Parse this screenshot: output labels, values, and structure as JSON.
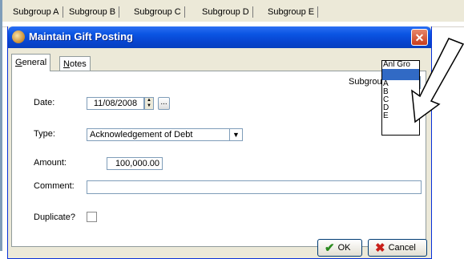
{
  "background_grid": {
    "columns": [
      "Subgroup A",
      "Subgroup B",
      "Subgroup C",
      "Subgroup D",
      "Subgroup E"
    ]
  },
  "dialog": {
    "title": "Maintain Gift Posting",
    "close_glyph": "✕",
    "tabs": [
      {
        "label": "General",
        "active": true
      },
      {
        "label": "Notes",
        "active": false
      }
    ],
    "subgroup": {
      "label": "Subgroup:",
      "options": [
        "Anl Gro",
        "",
        "A",
        "B",
        "C",
        "D",
        "E"
      ],
      "selected_index": 1
    },
    "date": {
      "label": "Date:",
      "value": "11/08/2008",
      "picker_label": "..."
    },
    "type": {
      "label": "Type:",
      "value": "Acknowledgement of Debt"
    },
    "amount": {
      "label": "Amount:",
      "value": "100,000.00"
    },
    "comment": {
      "label": "Comment:",
      "value": ""
    },
    "duplicate": {
      "label": "Duplicate?",
      "checked": false
    },
    "buttons": {
      "ok": "OK",
      "cancel": "Cancel"
    }
  },
  "colors": {
    "titlebar": "#0a55e3",
    "selection": "#316ac5",
    "ok_icon": "#2b8a1f",
    "cancel_icon": "#c8201a"
  },
  "icons": {
    "app": "app-icon",
    "close": "close-icon",
    "ok": "check-icon",
    "cancel": "x-icon",
    "annotation": "pointer-arrow-icon"
  }
}
